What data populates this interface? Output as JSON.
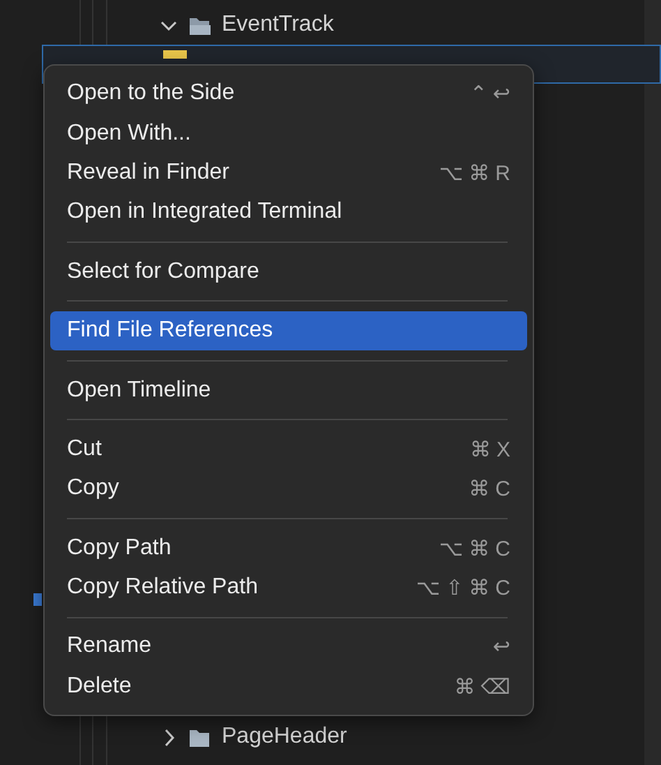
{
  "explorer": {
    "rows": [
      {
        "kind": "folder",
        "label": "EventTrack",
        "expanded": true,
        "selected": false
      },
      {
        "kind": "file",
        "selected": true
      },
      {
        "kind": "folder",
        "label": "PageHeader",
        "expanded": false,
        "selected": false
      }
    ]
  },
  "context_menu": {
    "groups": [
      [
        {
          "label": "Open to the Side",
          "shortcut": "⌃↩",
          "selected": false
        },
        {
          "label": "Open With...",
          "selected": false
        },
        {
          "label": "Reveal in Finder",
          "shortcut": "⌥⌘R",
          "selected": false
        },
        {
          "label": "Open in Integrated Terminal",
          "selected": false
        }
      ],
      [
        {
          "label": "Select for Compare",
          "selected": false
        }
      ],
      [
        {
          "label": "Find File References",
          "selected": true
        }
      ],
      [
        {
          "label": "Open Timeline",
          "selected": false
        }
      ],
      [
        {
          "label": "Cut",
          "shortcut": "⌘X",
          "selected": false
        },
        {
          "label": "Copy",
          "shortcut": "⌘C",
          "selected": false
        }
      ],
      [
        {
          "label": "Copy Path",
          "shortcut": "⌥⌘C",
          "selected": false
        },
        {
          "label": "Copy Relative Path",
          "shortcut": "⌥⇧⌘C",
          "selected": false
        }
      ],
      [
        {
          "label": "Rename",
          "shortcut": "↩",
          "selected": false
        },
        {
          "label": "Delete",
          "shortcut": "⌘⌫",
          "selected": false
        }
      ]
    ]
  }
}
